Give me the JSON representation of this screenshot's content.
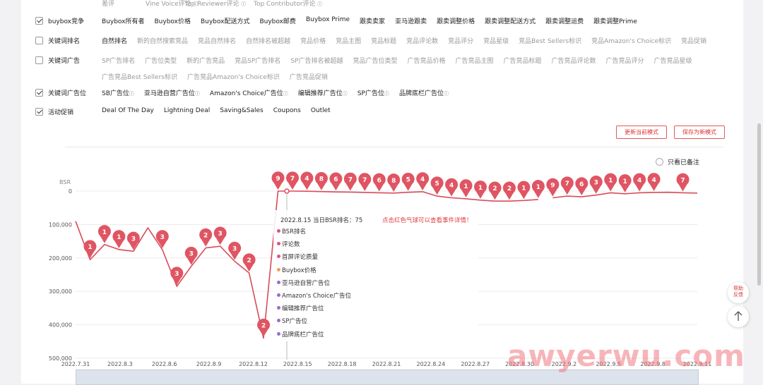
{
  "top_cut": [
    "差评",
    "Vine Voice评论",
    "Top Reviewer评论",
    "Top Contributor评论"
  ],
  "filters": [
    {
      "label": "buybox竞争",
      "checked": true,
      "lines": [
        [
          {
            "t": "Buybox所有者"
          },
          {
            "t": "Buybox价格"
          },
          {
            "t": "Buybox配送方式"
          },
          {
            "t": "Buybox邮费"
          },
          {
            "t": "Buybox Prime"
          },
          {
            "t": "跟卖卖家"
          },
          {
            "t": "亚马逊跟卖"
          },
          {
            "t": "跟卖调整价格"
          },
          {
            "t": "跟卖调整配送方式"
          },
          {
            "t": "跟卖调整运费"
          },
          {
            "t": "跟卖调整Prime"
          }
        ]
      ]
    },
    {
      "label": "关键词排名",
      "checked": false,
      "lines": [
        [
          {
            "t": "自然排名"
          },
          {
            "t": "新的自然搜索竞品",
            "dim": true
          },
          {
            "t": "竞品自然排名",
            "dim": true
          },
          {
            "t": "自然排名被超越",
            "dim": true
          },
          {
            "t": "竞品价格",
            "dim": true
          },
          {
            "t": "竞品主图",
            "dim": true
          },
          {
            "t": "竞品标题",
            "dim": true
          },
          {
            "t": "竞品评论数",
            "dim": true
          },
          {
            "t": "竞品评分",
            "dim": true
          },
          {
            "t": "竞品星级",
            "dim": true
          },
          {
            "t": "竞品Best Sellers标识",
            "dim": true
          },
          {
            "t": "竞品Amazon's Choice标识",
            "dim": true
          },
          {
            "t": "竞品促销",
            "dim": true
          }
        ]
      ]
    },
    {
      "label": "关键词广告",
      "checked": false,
      "lines": [
        [
          {
            "t": "SP广告排名",
            "dim": true
          },
          {
            "t": "广告位类型",
            "dim": true
          },
          {
            "t": "新的广告竞品",
            "dim": true
          },
          {
            "t": "竞品SP广告排名",
            "dim": true
          },
          {
            "t": "SP广告排名被超越",
            "dim": true
          },
          {
            "t": "竞品广告位类型",
            "dim": true
          },
          {
            "t": "广告竞品价格",
            "dim": true
          },
          {
            "t": "广告竞品主图",
            "dim": true
          },
          {
            "t": "广告竞品标题",
            "dim": true
          },
          {
            "t": "广告竞品评论数",
            "dim": true
          },
          {
            "t": "广告竞品评分",
            "dim": true
          },
          {
            "t": "广告竞品星级",
            "dim": true
          }
        ],
        [
          {
            "t": "广告竞品Best Sellers标识",
            "dim": true
          },
          {
            "t": "广告竞品Amazon's Choice标识",
            "dim": true
          },
          {
            "t": "广告竞品促销",
            "dim": true
          }
        ]
      ]
    },
    {
      "label": "关键词广告位",
      "checked": true,
      "lines": [
        [
          {
            "t": "SB广告位",
            "q": true
          },
          {
            "t": "亚马逊自营广告位",
            "q": true
          },
          {
            "t": "Amazon's Choice广告位",
            "q": true
          },
          {
            "t": "编辑推荐广告位",
            "q": true
          },
          {
            "t": "SP广告位",
            "q": true
          },
          {
            "t": "品牌底栏广告位",
            "q": true
          }
        ]
      ]
    },
    {
      "label": "活动促销",
      "checked": true,
      "lines": [
        [
          {
            "t": "Deal Of The Day"
          },
          {
            "t": "Lightning Deal"
          },
          {
            "t": "Saving&Sales"
          },
          {
            "t": "Coupons"
          },
          {
            "t": "Outlet"
          }
        ]
      ]
    }
  ],
  "buttons": {
    "update_mode": "更新当前模式",
    "save_mode": "保存为新模式"
  },
  "only_noted": "只看已备注",
  "chart_data": {
    "type": "line",
    "ylabel": "BSR",
    "y_inverted": true,
    "ylim": [
      0,
      500000
    ],
    "y_ticks": [
      "0",
      "100,000",
      "200,000",
      "300,000",
      "400,000",
      "500,000"
    ],
    "x_ticks": [
      "2022.7.31",
      "2022.8.3",
      "2022.8.6",
      "2022.8.9",
      "2022.8.12",
      "2022.8.15",
      "2022.8.18",
      "2022.8.21",
      "2022.8.24",
      "2022.8.27",
      "2022.8.30",
      "2022.9.2",
      "2022.9.5",
      "2022.9.8",
      "2022.9.11"
    ],
    "series": [
      {
        "name": "BSR排名",
        "color": "#d94b5a",
        "segments": [
          [
            [
              0,
              90000
            ],
            [
              1,
              205000
            ],
            [
              2,
              160000
            ],
            [
              3,
              175000
            ],
            [
              4,
              180000
            ],
            [
              5,
              110000
            ],
            [
              6,
              175000
            ],
            [
              7,
              285000
            ],
            [
              8,
              225000
            ],
            [
              9,
              170000
            ],
            [
              10,
              165000
            ],
            [
              11,
              210000
            ],
            [
              12,
              245000
            ],
            [
              13,
              440000
            ],
            [
              14,
              0
            ],
            [
              15,
              75
            ],
            [
              16,
              500
            ],
            [
              17,
              1500
            ],
            [
              18,
              2500
            ],
            [
              19,
              3000
            ],
            [
              20,
              4000
            ],
            [
              21,
              5000
            ],
            [
              22,
              6000
            ],
            [
              23,
              3500
            ],
            [
              24,
              2000
            ],
            [
              25,
              15000
            ],
            [
              26,
              20000
            ],
            [
              27,
              23000
            ],
            [
              28,
              27000
            ],
            [
              29,
              30000
            ],
            [
              30,
              30000
            ],
            [
              31,
              28000
            ],
            [
              32,
              25000
            ]
          ],
          [
            [
              33,
              20000
            ],
            [
              34,
              15000
            ],
            [
              35,
              17000
            ],
            [
              36,
              12000
            ],
            [
              37,
              5000
            ],
            [
              38,
              8000
            ],
            [
              39,
              5000
            ],
            [
              40,
              4000
            ],
            [
              41,
              3500
            ],
            [
              42,
              5000
            ],
            [
              43,
              6000
            ]
          ]
        ]
      }
    ],
    "markers": [
      "1",
      "1",
      "1",
      "3",
      "3",
      "3",
      "3",
      "2",
      "3",
      "3",
      "2",
      "2",
      "9",
      "7",
      "4",
      "8",
      "6",
      "7",
      "7",
      "6",
      "8",
      "5",
      "4",
      "5",
      "4",
      "1",
      "1",
      "2",
      "2",
      "1",
      "1",
      "9",
      "7",
      "6",
      "3",
      "1",
      "1",
      "4",
      "4",
      "7"
    ]
  },
  "tooltip": {
    "date_rank": "2022.8.15 当日BSR排名：75",
    "hint": "点击红色气球可以查看事件详情！",
    "items": [
      {
        "label": "BSR排名",
        "color": "#e0508a"
      },
      {
        "label": "评论数",
        "color": "#e0508a"
      },
      {
        "label": "首屏评论质量",
        "color": "#e0508a"
      },
      {
        "label": "Buybox价格",
        "color": "#e8a060"
      },
      {
        "label": "亚马逊自营广告位",
        "color": "#9b6ad0"
      },
      {
        "label": "Amazon's Choice广告位",
        "color": "#9b6ad0"
      },
      {
        "label": "编辑推荐广告位",
        "color": "#9b6ad0"
      },
      {
        "label": "SP广告位",
        "color": "#9b6ad0"
      },
      {
        "label": "品牌底栏广告位",
        "color": "#9b6ad0"
      }
    ]
  },
  "side": {
    "help": "帮助反馈",
    "top_icon": "arrow-up-icon"
  },
  "watermark": "awyerwu.com"
}
